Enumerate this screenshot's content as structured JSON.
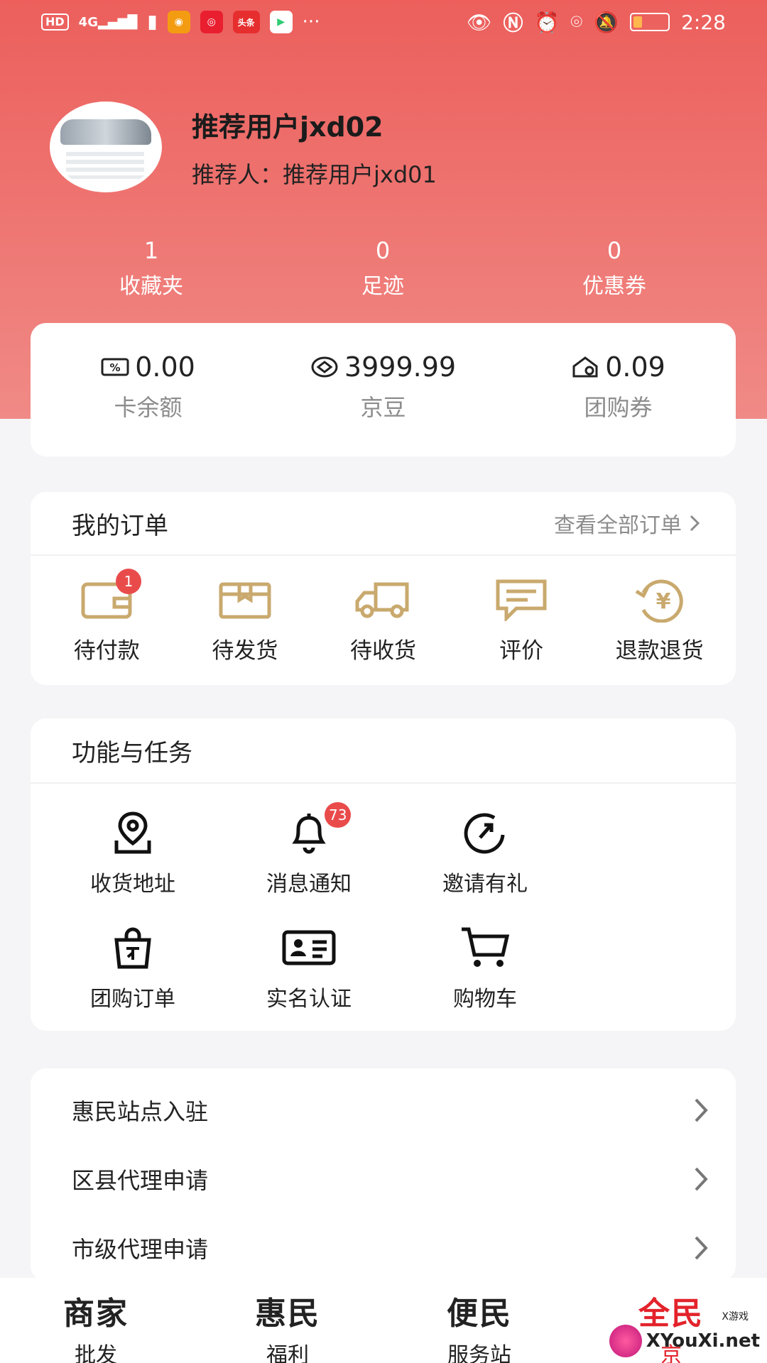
{
  "status_bar": {
    "left": [
      "HD",
      "4G"
    ],
    "time": "2:28",
    "app_icons": [
      "uc",
      "weibo",
      "toutiao",
      "video"
    ],
    "toutiao_label": "头条"
  },
  "profile": {
    "name": "推荐用户jxd02",
    "referrer": "推荐人：推荐用户jxd01"
  },
  "stats": [
    {
      "value": "1",
      "label": "收藏夹"
    },
    {
      "value": "0",
      "label": "足迹"
    },
    {
      "value": "0",
      "label": "优惠券"
    }
  ],
  "wallet": [
    {
      "icon": "card-balance-icon",
      "value": "0.00",
      "label": "卡余额"
    },
    {
      "icon": "jingdou-icon",
      "value": "3999.99",
      "label": "京豆"
    },
    {
      "icon": "group-coupon-icon",
      "value": "0.09",
      "label": "团购券"
    }
  ],
  "orders": {
    "title": "我的订单",
    "view_all": "查看全部订单",
    "items": [
      {
        "label": "待付款",
        "badge": "1",
        "icon": "wallet-icon"
      },
      {
        "label": "待发货",
        "icon": "box-icon"
      },
      {
        "label": "待收货",
        "icon": "truck-icon"
      },
      {
        "label": "评价",
        "icon": "comment-icon"
      },
      {
        "label": "退款退货",
        "icon": "refund-icon"
      }
    ]
  },
  "functions": {
    "title": "功能与任务",
    "items": [
      {
        "label": "收货地址",
        "icon": "location-icon"
      },
      {
        "label": "消息通知",
        "badge": "73",
        "icon": "bell-icon"
      },
      {
        "label": "邀请有礼",
        "icon": "invite-icon"
      },
      {
        "label": "团购订单",
        "icon": "shopping-bag-icon"
      },
      {
        "label": "实名认证",
        "icon": "id-card-icon"
      },
      {
        "label": "购物车",
        "icon": "cart-icon"
      }
    ]
  },
  "links": [
    {
      "label": "惠民站点入驻"
    },
    {
      "label": "区县代理申请"
    },
    {
      "label": "市级代理申请"
    }
  ],
  "tabbar": [
    {
      "title": "商家",
      "sub": "批发"
    },
    {
      "title": "惠民",
      "sub": "福利"
    },
    {
      "title": "便民",
      "sub": "服务站"
    },
    {
      "title": "全民",
      "sub": "京"
    }
  ],
  "watermark": {
    "text": "XYouXi.net",
    "small": "X游戏"
  },
  "colors": {
    "header": "#ec5f5c",
    "accent": "#e3232b",
    "icon_gold": "#c9a96e",
    "badge": "#e94b4b"
  }
}
